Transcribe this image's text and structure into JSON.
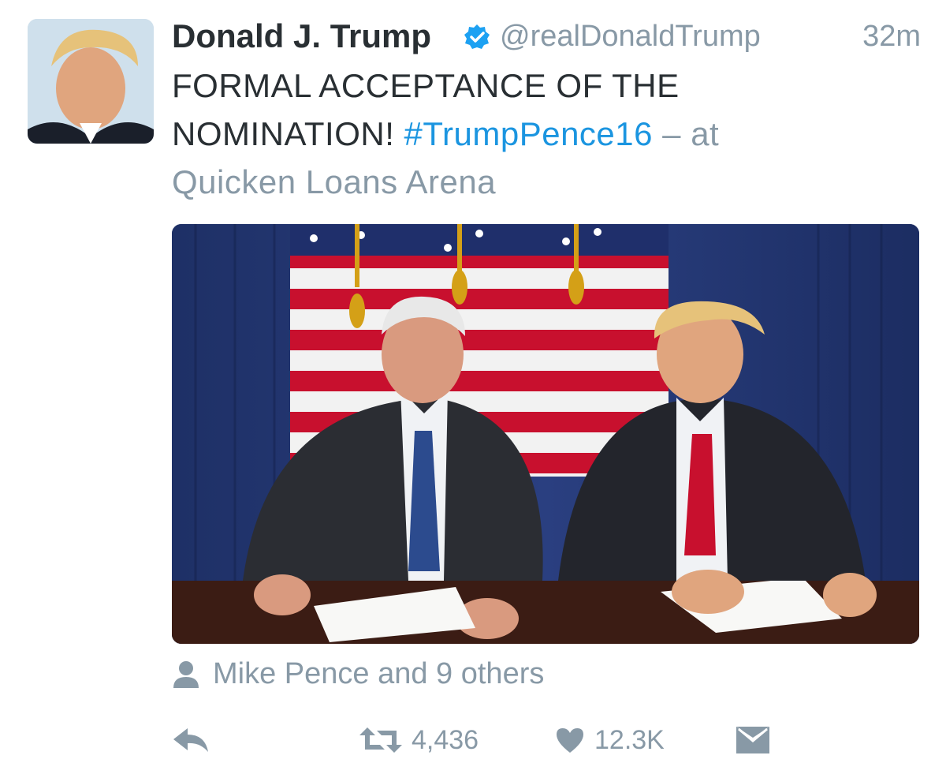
{
  "author": {
    "name": "Donald J. Trump",
    "handle": "@realDonaldTrump",
    "verified": true,
    "time": "32m"
  },
  "tweet": {
    "text_main": "FORMAL ACCEPTANCE OF THE NOMINATION! ",
    "hashtag": "#TrumpPence16",
    "at_text": " – at",
    "location": "Quicken Loans Arena"
  },
  "media": {
    "photo_icon": "photo-of-nomination-signing"
  },
  "tagged": {
    "text": "Mike Pence and 9 others",
    "icon": "person-icon"
  },
  "actions": {
    "retweet_count": "4,436",
    "like_count": "12.3K"
  },
  "colors": {
    "link": "#1b95e0",
    "secondary": "#8899a6",
    "text": "#292f33",
    "verified": "#1da1f2"
  }
}
